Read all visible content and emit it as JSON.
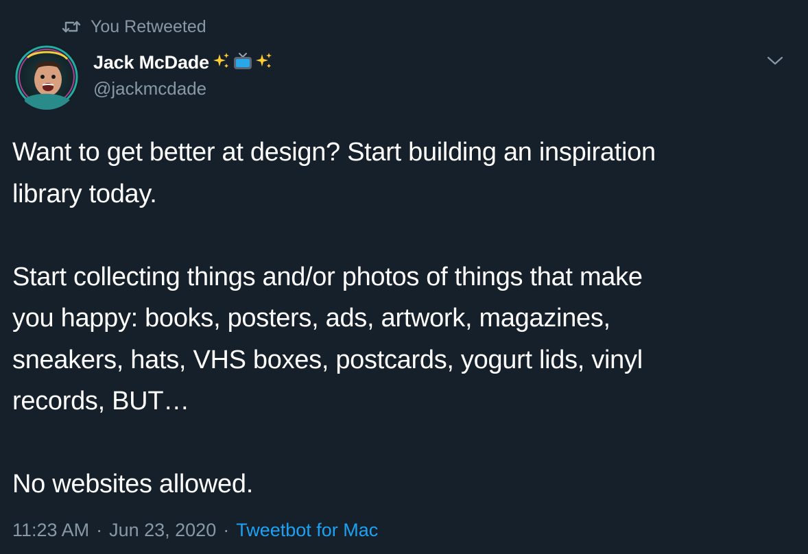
{
  "retweet_banner": {
    "icon": "retweet-icon",
    "label": "You Retweeted"
  },
  "author": {
    "display_name": "Jack McDade",
    "name_emoji": [
      "sparkles-icon",
      "television-icon",
      "sparkles-icon"
    ],
    "handle": "@jackmcdade",
    "avatar": "avatar"
  },
  "menu": {
    "icon": "chevron-down-icon"
  },
  "tweet": {
    "paragraphs": [
      "Want to get better at design? Start building an inspiration\nlibrary today.",
      "Start collecting things and/or photos of things that make\nyou happy: books, posters, ads, artwork, magazines,\nsneakers, hats, VHS boxes, postcards, yogurt lids, vinyl\nrecords, BUT…",
      "No websites allowed."
    ]
  },
  "meta": {
    "time": "11:23 AM",
    "separator": "·",
    "date": "Jun 23, 2020",
    "client": "Tweetbot for Mac"
  },
  "colors": {
    "background": "#15202b",
    "text": "#ffffff",
    "secondary": "#8899a6",
    "link": "#1da1f2"
  }
}
